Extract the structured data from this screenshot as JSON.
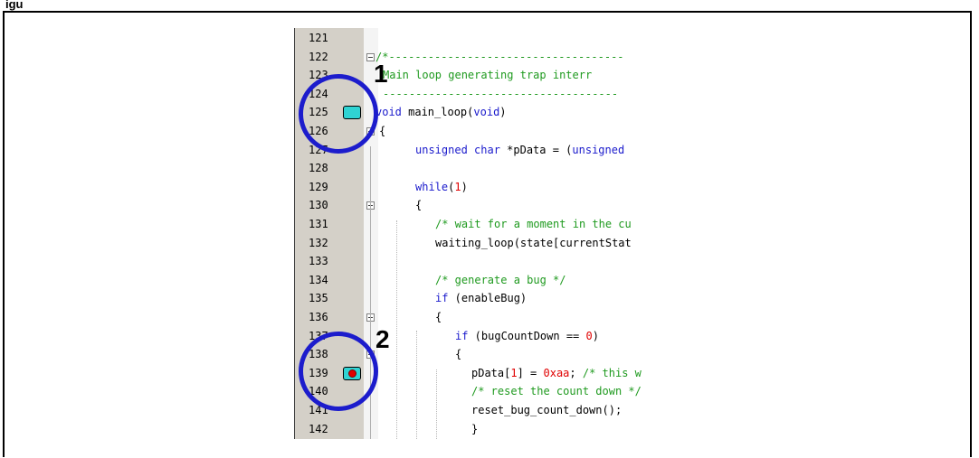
{
  "figure_label": "igu",
  "editor": {
    "first_line": 121,
    "rows": [
      {
        "num": "121",
        "tokens": []
      },
      {
        "num": "122",
        "tokens": [
          {
            "t": "/*------------------------------------",
            "c": "#1f9a1f"
          }
        ]
      },
      {
        "num": "123",
        "tokens": [
          {
            "t": "Main loop generating trap interr",
            "c": "#1f9a1f"
          }
        ]
      },
      {
        "num": "124",
        "tokens": [
          {
            "t": "------------------------------------",
            "c": "#1f9a1f"
          }
        ]
      },
      {
        "num": "125",
        "tokens": [
          {
            "t": "void",
            "c": "#1a1acc"
          },
          {
            "t": " main_loop(",
            "c": "#000000"
          },
          {
            "t": "void",
            "c": "#1a1acc"
          },
          {
            "t": ")",
            "c": "#000000"
          }
        ]
      },
      {
        "num": "126",
        "tokens": [
          {
            "t": "{",
            "c": "#000000"
          }
        ]
      },
      {
        "num": "127",
        "tokens": [
          {
            "t": "unsigned char",
            "c": "#1a1acc"
          },
          {
            "t": " *pData = (",
            "c": "#000000"
          },
          {
            "t": "unsigned",
            "c": "#1a1acc"
          }
        ]
      },
      {
        "num": "128",
        "tokens": []
      },
      {
        "num": "129",
        "tokens": [
          {
            "t": "while",
            "c": "#1a1acc"
          },
          {
            "t": "(",
            "c": "#000000"
          },
          {
            "t": "1",
            "c": "#e00000"
          },
          {
            "t": ")",
            "c": "#000000"
          }
        ]
      },
      {
        "num": "130",
        "tokens": [
          {
            "t": "{",
            "c": "#000000"
          }
        ]
      },
      {
        "num": "131",
        "tokens": [
          {
            "t": "/* wait for a moment in the cu",
            "c": "#1f9a1f"
          }
        ]
      },
      {
        "num": "132",
        "tokens": [
          {
            "t": "waiting_loop(state[currentStat",
            "c": "#000000"
          }
        ]
      },
      {
        "num": "133",
        "tokens": []
      },
      {
        "num": "134",
        "tokens": [
          {
            "t": "/* generate a bug */",
            "c": "#1f9a1f"
          }
        ]
      },
      {
        "num": "135",
        "tokens": [
          {
            "t": "if",
            "c": "#1a1acc"
          },
          {
            "t": " (enableBug)",
            "c": "#000000"
          }
        ]
      },
      {
        "num": "136",
        "tokens": [
          {
            "t": "{",
            "c": "#000000"
          }
        ]
      },
      {
        "num": "137",
        "tokens": [
          {
            "t": "if",
            "c": "#1a1acc"
          },
          {
            "t": " (bugCountDown == ",
            "c": "#000000"
          },
          {
            "t": "0",
            "c": "#e00000"
          },
          {
            "t": ")",
            "c": "#000000"
          }
        ]
      },
      {
        "num": "138",
        "tokens": [
          {
            "t": "{",
            "c": "#000000"
          }
        ]
      },
      {
        "num": "139",
        "tokens": [
          {
            "t": "pData[",
            "c": "#000000"
          },
          {
            "t": "1",
            "c": "#e00000"
          },
          {
            "t": "] = ",
            "c": "#000000"
          },
          {
            "t": "0xaa",
            "c": "#e00000"
          },
          {
            "t": "; ",
            "c": "#000000"
          },
          {
            "t": "/* this w",
            "c": "#1f9a1f"
          }
        ]
      },
      {
        "num": "140",
        "tokens": [
          {
            "t": "/* reset the count down */",
            "c": "#1f9a1f"
          }
        ]
      },
      {
        "num": "141",
        "tokens": [
          {
            "t": "reset_bug_count_down();",
            "c": "#000000"
          }
        ]
      },
      {
        "num": "142",
        "tokens": [
          {
            "t": "}",
            "c": "#000000"
          }
        ]
      }
    ]
  },
  "callouts": [
    {
      "label": "1",
      "line": "125",
      "marker": "bookmark"
    },
    {
      "label": "2",
      "line": "139",
      "marker": "breakpoint"
    }
  ],
  "colors": {
    "gutter": "#d4d0c8",
    "bookmark": "#2fd3d3",
    "breakpoint": "#e00000",
    "callout": "#1c1ccc",
    "keyword": "#1a1acc",
    "comment": "#1f9a1f",
    "number": "#e00000"
  }
}
